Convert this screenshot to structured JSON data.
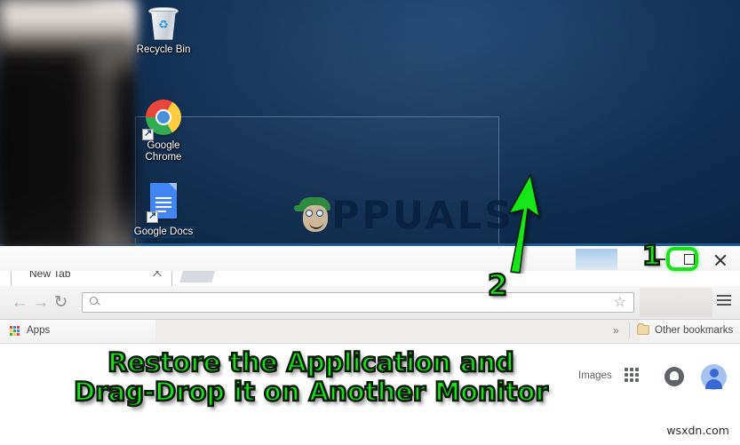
{
  "desktop": {
    "icons": [
      {
        "label": "Recycle Bin",
        "icon": "recycle-bin-icon",
        "selected": false
      },
      {
        "label": "Google\nChrome",
        "label_line1": "Google",
        "label_line2": "Chrome",
        "icon": "chrome-icon",
        "selected": false
      },
      {
        "label": "Google Docs",
        "icon": "google-docs-icon",
        "selected": true
      }
    ],
    "watermark": "PPUALS",
    "watermark_full": "APPUALS"
  },
  "annotations": {
    "step1_label": "1",
    "step2_label": "2",
    "caption_line1": "Restore the Application and",
    "caption_line2": "Drag-Drop it on Another Monitor",
    "highlight_color": "#1fe01f",
    "caption_color": "#18e418",
    "caption_outline": "#0c1a0c"
  },
  "browser": {
    "window_controls": {
      "minimize": "minimize-icon",
      "restore": "restore-icon",
      "close": "close-icon"
    },
    "tabs": [
      {
        "title": "New Tab",
        "close": "close-icon"
      }
    ],
    "new_tab_button": "new-tab-icon",
    "nav": {
      "back": "←",
      "forward": "→",
      "reload": "↻"
    },
    "omnibox": {
      "value": "",
      "placeholder": "",
      "search_icon": "search-icon",
      "bookmark_star": "☆"
    },
    "menu_icon": "hamburger-menu-icon",
    "bookmarks": {
      "apps_label": "Apps",
      "apps_icon": "apps-grid-icon",
      "overflow": "»",
      "other_bookmarks": "Other bookmarks",
      "folder_icon": "folder-icon"
    }
  },
  "page": {
    "images_link": "Images",
    "google_apps_icon": "google-apps-grid-icon",
    "notifications_icon": "bell-icon",
    "account_icon": "avatar-icon"
  },
  "footer": {
    "watermark": "wsxdn.com"
  }
}
